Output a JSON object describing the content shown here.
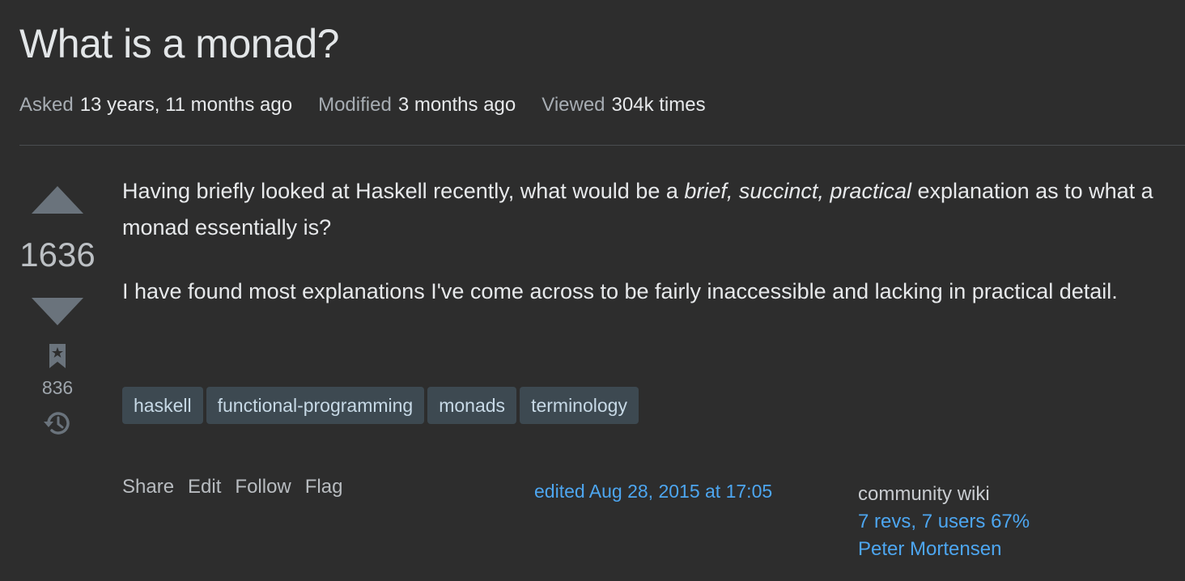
{
  "question": {
    "title": "What is a monad?",
    "meta": {
      "asked_label": "Asked",
      "asked_value": "13 years, 11 months ago",
      "modified_label": "Modified",
      "modified_value": "3 months ago",
      "viewed_label": "Viewed",
      "viewed_value": "304k times"
    },
    "votes": "1636",
    "bookmarks": "836",
    "body": {
      "p1_before": "Having briefly looked at Haskell recently, what would be a ",
      "p1_emphasis": "brief, succinct, practical",
      "p1_after": " explanation as to what a monad essentially is?",
      "p2": "I have found most explanations I've come across to be fairly inaccessible and lacking in practical detail."
    },
    "tags": [
      "haskell",
      "functional-programming",
      "monads",
      "terminology"
    ],
    "post_menu": {
      "share": "Share",
      "edit": "Edit",
      "follow": "Follow",
      "flag": "Flag"
    },
    "edited": "edited Aug 28, 2015 at 17:05",
    "community": {
      "label": "community wiki",
      "revs": "7 revs, 7 users 67%",
      "user": "Peter Mortensen"
    }
  },
  "icons": {
    "upvote": "upvote-arrow-icon",
    "downvote": "downvote-arrow-icon",
    "bookmark": "bookmark-icon",
    "history": "history-icon"
  },
  "colors": {
    "background": "#2d2d2d",
    "link": "#4da6f0",
    "tag_bg": "#3d4951",
    "tag_text": "#c7d9e6"
  }
}
